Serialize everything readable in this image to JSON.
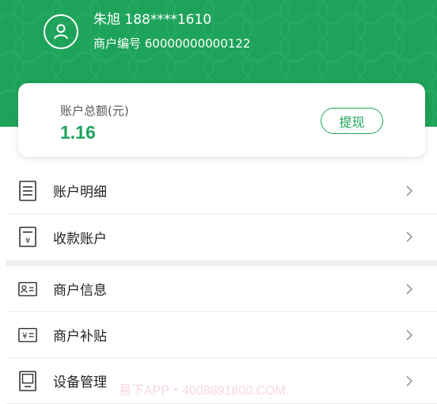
{
  "merchant": {
    "name_phone": "朱旭 188****1610",
    "merchant_id": "商户编号 60000000000122"
  },
  "balance": {
    "label": "账户总额(元)",
    "value": "1.16",
    "withdraw_label": "提现"
  },
  "menu": {
    "group1": [
      {
        "label": "账户明细",
        "icon": "document-icon"
      },
      {
        "label": "收款账户",
        "icon": "yuan-document-icon"
      }
    ],
    "group2": [
      {
        "label": "商户信息",
        "icon": "id-card-icon"
      },
      {
        "label": "商户补贴",
        "icon": "yuan-card-icon"
      },
      {
        "label": "设备管理",
        "icon": "device-icon"
      }
    ]
  },
  "watermark": "易下APP・4008891800.COM",
  "colors": {
    "brand_green": "#1ea35a",
    "pattern_green": "#2fae67",
    "section_gap": "#f0eff4"
  }
}
